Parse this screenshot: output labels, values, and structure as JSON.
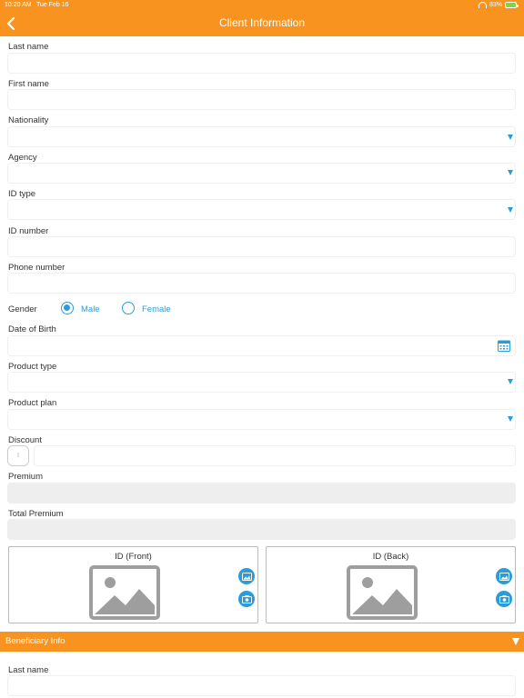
{
  "status_bar": {
    "time": "10:20 AM",
    "date": "Tue Feb 16",
    "battery": "83%"
  },
  "nav": {
    "title": "Client Information"
  },
  "form": {
    "last_name": {
      "label": "Last name",
      "value": ""
    },
    "first_name": {
      "label": "First name",
      "value": ""
    },
    "nationality": {
      "label": "Nationality",
      "value": ""
    },
    "agency": {
      "label": "Agency",
      "value": ""
    },
    "id_type": {
      "label": "ID type",
      "value": ""
    },
    "id_number": {
      "label": "ID number",
      "value": ""
    },
    "phone_number": {
      "label": "Phone number",
      "value": ""
    },
    "gender": {
      "label": "Gender",
      "options": [
        "Male",
        "Female"
      ],
      "selected": "Male"
    },
    "date_of_birth": {
      "label": "Date of Birth",
      "value": ""
    },
    "product_type": {
      "label": "Product type",
      "value": ""
    },
    "product_plan": {
      "label": "Product plan",
      "value": ""
    },
    "discount": {
      "label": "Discount",
      "prefix": "I",
      "value": ""
    },
    "premium": {
      "label": "Premium",
      "value": ""
    },
    "total_premium": {
      "label": "Total Premium",
      "value": ""
    }
  },
  "id_images": {
    "front_label": "ID (Front)",
    "back_label": "ID (Back)"
  },
  "beneficiary": {
    "section_title": "Beneficiary Info",
    "last_name": {
      "label": "Last name",
      "value": ""
    }
  },
  "colors": {
    "accent": "#f7931e",
    "link": "#2a9dd8",
    "disabled_field": "#eeeeee"
  },
  "icons": [
    "back-chevron-icon",
    "wifi-icon",
    "battery-icon",
    "dropdown-caret-icon",
    "calendar-icon",
    "image-placeholder-icon",
    "gallery-icon",
    "camera-icon"
  ]
}
